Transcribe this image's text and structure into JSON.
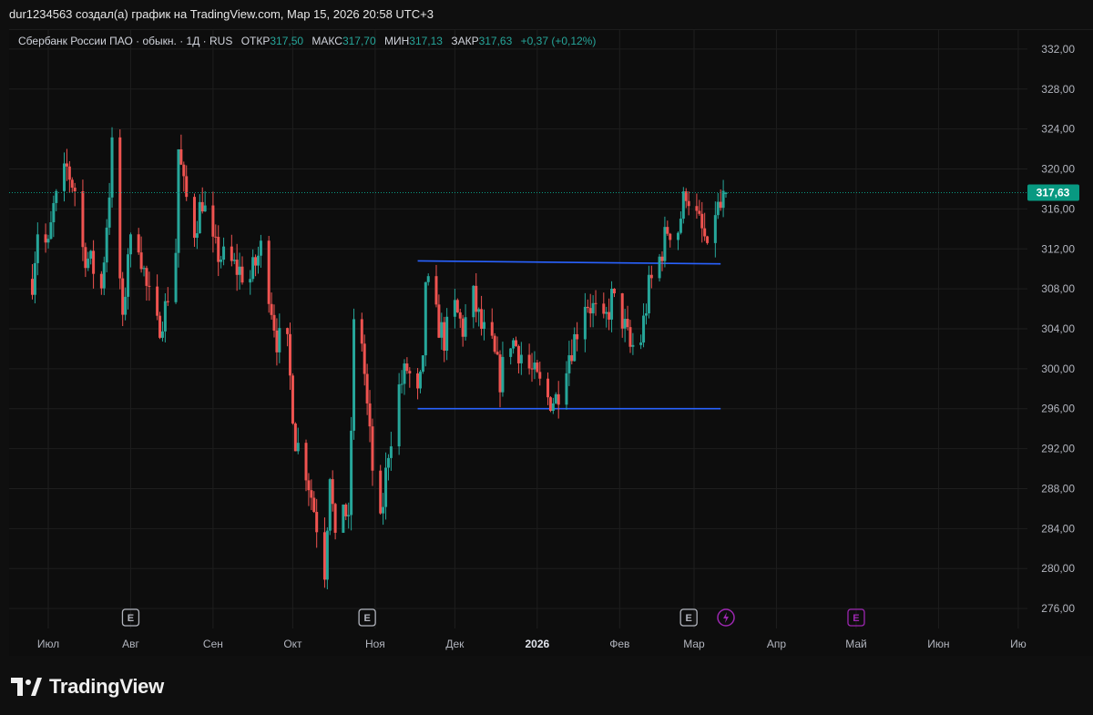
{
  "caption": "dur1234563 создал(а) график на TradingView.com, Мар 15, 2026 20:58 UTC+3",
  "legend": {
    "symbol": "Сбербанк России ПАО · обыкн. · 1Д · RUS",
    "open_label": "ОТКР",
    "open": "317,50",
    "high_label": "МАКС",
    "high": "317,70",
    "low_label": "МИН",
    "low": "317,13",
    "close_label": "ЗАКР",
    "close": "317,63",
    "change": "+0,37 (+0,12%)"
  },
  "colors": {
    "background": "#0d0d0d",
    "up": "#26a69a",
    "down": "#ef5350",
    "line": "#2962ff",
    "grid": "#1e1e1e",
    "text": "#b2b5be",
    "price_tag": "#089981",
    "flash": "#9c27b0"
  },
  "logo_text": "TradingView",
  "chart_data": {
    "type": "candlestick",
    "title": "Сбербанк России ПАО · обыкн. · 1Д · RUS",
    "last_price": 317.63,
    "last_price_label": "317,63",
    "y_axis": {
      "min": 274,
      "max": 334,
      "ticks": [
        332,
        328,
        324,
        320,
        316,
        312,
        308,
        304,
        300,
        296,
        292,
        288,
        284,
        280,
        276
      ],
      "tick_labels": [
        "332,00",
        "328,00",
        "324,00",
        "320,00",
        "316,00",
        "312,00",
        "308,00",
        "304,00",
        "300,00",
        "296,00",
        "292,00",
        "288,00",
        "284,00",
        "280,00",
        "276,00"
      ]
    },
    "x_axis": {
      "labels": [
        {
          "label": "Июл",
          "date": "2025-07-01",
          "bold": false
        },
        {
          "label": "Авг",
          "date": "2025-08-01",
          "bold": false
        },
        {
          "label": "Сен",
          "date": "2025-09-01",
          "bold": false
        },
        {
          "label": "Окт",
          "date": "2025-10-01",
          "bold": false
        },
        {
          "label": "Ноя",
          "date": "2025-11-01",
          "bold": false
        },
        {
          "label": "Дек",
          "date": "2025-12-01",
          "bold": false
        },
        {
          "label": "2026",
          "date": "2026-01-01",
          "bold": true
        },
        {
          "label": "Фев",
          "date": "2026-02-01",
          "bold": false
        },
        {
          "label": "Мар",
          "date": "2026-03-01",
          "bold": false
        },
        {
          "label": "Апр",
          "date": "2026-04-01",
          "bold": false
        },
        {
          "label": "Май",
          "date": "2026-05-01",
          "bold": false
        },
        {
          "label": "Июн",
          "date": "2026-06-01",
          "bold": false
        },
        {
          "label": "Ию",
          "date": "2026-07-01",
          "bold": false
        }
      ]
    },
    "events": [
      {
        "type": "earnings",
        "label": "E",
        "date": "2025-08-01"
      },
      {
        "type": "earnings",
        "label": "E",
        "date": "2025-10-29"
      },
      {
        "type": "earnings",
        "label": "E",
        "date": "2026-02-27"
      },
      {
        "type": "flash",
        "label": "⚡",
        "date": "2026-03-13"
      },
      {
        "type": "earnings-future",
        "label": "E",
        "date": "2026-05-01"
      }
    ],
    "trend_lines": [
      {
        "x1": "2025-11-17",
        "y1": 310.8,
        "x2": "2026-03-11",
        "y2": 310.5
      },
      {
        "x1": "2025-11-17",
        "y1": 296.0,
        "x2": "2026-03-11",
        "y2": 296.0
      }
    ],
    "series_path": [
      {
        "date": "2025-06-25",
        "price": 309
      },
      {
        "date": "2025-06-27",
        "price": 314
      },
      {
        "date": "2025-07-01",
        "price": 312
      },
      {
        "date": "2025-07-03",
        "price": 316
      },
      {
        "date": "2025-07-08",
        "price": 320
      },
      {
        "date": "2025-07-11",
        "price": 318
      },
      {
        "date": "2025-07-14",
        "price": 312
      },
      {
        "date": "2025-07-18",
        "price": 310
      },
      {
        "date": "2025-07-21",
        "price": 308
      },
      {
        "date": "2025-07-24",
        "price": 318
      },
      {
        "date": "2025-07-25",
        "price": 322
      },
      {
        "date": "2025-07-28",
        "price": 309
      },
      {
        "date": "2025-07-29",
        "price": 304
      },
      {
        "date": "2025-07-31",
        "price": 312
      },
      {
        "date": "2025-08-04",
        "price": 313
      },
      {
        "date": "2025-08-07",
        "price": 308
      },
      {
        "date": "2025-08-11",
        "price": 304
      },
      {
        "date": "2025-08-14",
        "price": 306
      },
      {
        "date": "2025-08-18",
        "price": 312
      },
      {
        "date": "2025-08-19",
        "price": 322
      },
      {
        "date": "2025-08-21",
        "price": 318
      },
      {
        "date": "2025-08-25",
        "price": 314
      },
      {
        "date": "2025-08-28",
        "price": 317
      },
      {
        "date": "2025-09-01",
        "price": 312
      },
      {
        "date": "2025-09-05",
        "price": 311
      },
      {
        "date": "2025-09-10",
        "price": 310
      },
      {
        "date": "2025-09-15",
        "price": 309
      },
      {
        "date": "2025-09-19",
        "price": 312
      },
      {
        "date": "2025-09-22",
        "price": 308
      },
      {
        "date": "2025-09-25",
        "price": 303
      },
      {
        "date": "2025-09-29",
        "price": 302
      },
      {
        "date": "2025-10-02",
        "price": 293
      },
      {
        "date": "2025-10-06",
        "price": 290
      },
      {
        "date": "2025-10-09",
        "price": 286
      },
      {
        "date": "2025-10-13",
        "price": 280
      },
      {
        "date": "2025-10-15",
        "price": 290
      },
      {
        "date": "2025-10-17",
        "price": 282
      },
      {
        "date": "2025-10-20",
        "price": 287
      },
      {
        "date": "2025-10-22",
        "price": 284
      },
      {
        "date": "2025-10-24",
        "price": 304
      },
      {
        "date": "2025-10-27",
        "price": 303
      },
      {
        "date": "2025-10-29",
        "price": 296
      },
      {
        "date": "2025-10-31",
        "price": 290
      },
      {
        "date": "2025-11-03",
        "price": 284
      },
      {
        "date": "2025-11-06",
        "price": 292
      },
      {
        "date": "2025-11-10",
        "price": 298
      },
      {
        "date": "2025-11-13",
        "price": 300
      },
      {
        "date": "2025-11-17",
        "price": 297
      },
      {
        "date": "2025-11-19",
        "price": 300
      },
      {
        "date": "2025-11-20",
        "price": 309
      },
      {
        "date": "2025-11-24",
        "price": 305
      },
      {
        "date": "2025-11-27",
        "price": 303
      },
      {
        "date": "2025-12-01",
        "price": 306
      },
      {
        "date": "2025-12-04",
        "price": 304
      },
      {
        "date": "2025-12-08",
        "price": 307
      },
      {
        "date": "2025-12-11",
        "price": 304
      },
      {
        "date": "2025-12-15",
        "price": 302
      },
      {
        "date": "2025-12-18",
        "price": 299
      },
      {
        "date": "2025-12-22",
        "price": 303
      },
      {
        "date": "2025-12-25",
        "price": 302
      },
      {
        "date": "2025-12-29",
        "price": 300
      },
      {
        "date": "2026-01-05",
        "price": 297
      },
      {
        "date": "2026-01-08",
        "price": 297
      },
      {
        "date": "2026-01-12",
        "price": 301
      },
      {
        "date": "2026-01-15",
        "price": 303
      },
      {
        "date": "2026-01-19",
        "price": 307
      },
      {
        "date": "2026-01-22",
        "price": 306
      },
      {
        "date": "2026-01-26",
        "price": 304
      },
      {
        "date": "2026-01-29",
        "price": 307
      },
      {
        "date": "2026-02-02",
        "price": 305
      },
      {
        "date": "2026-02-05",
        "price": 302
      },
      {
        "date": "2026-02-09",
        "price": 303
      },
      {
        "date": "2026-02-12",
        "price": 308
      },
      {
        "date": "2026-02-16",
        "price": 311
      },
      {
        "date": "2026-02-19",
        "price": 314
      },
      {
        "date": "2026-02-23",
        "price": 314
      },
      {
        "date": "2026-02-26",
        "price": 318
      },
      {
        "date": "2026-03-02",
        "price": 315
      },
      {
        "date": "2026-03-05",
        "price": 313
      },
      {
        "date": "2026-03-06",
        "price": 311
      },
      {
        "date": "2026-03-09",
        "price": 316
      },
      {
        "date": "2026-03-11",
        "price": 316
      },
      {
        "date": "2026-03-13",
        "price": 317.63
      }
    ]
  }
}
